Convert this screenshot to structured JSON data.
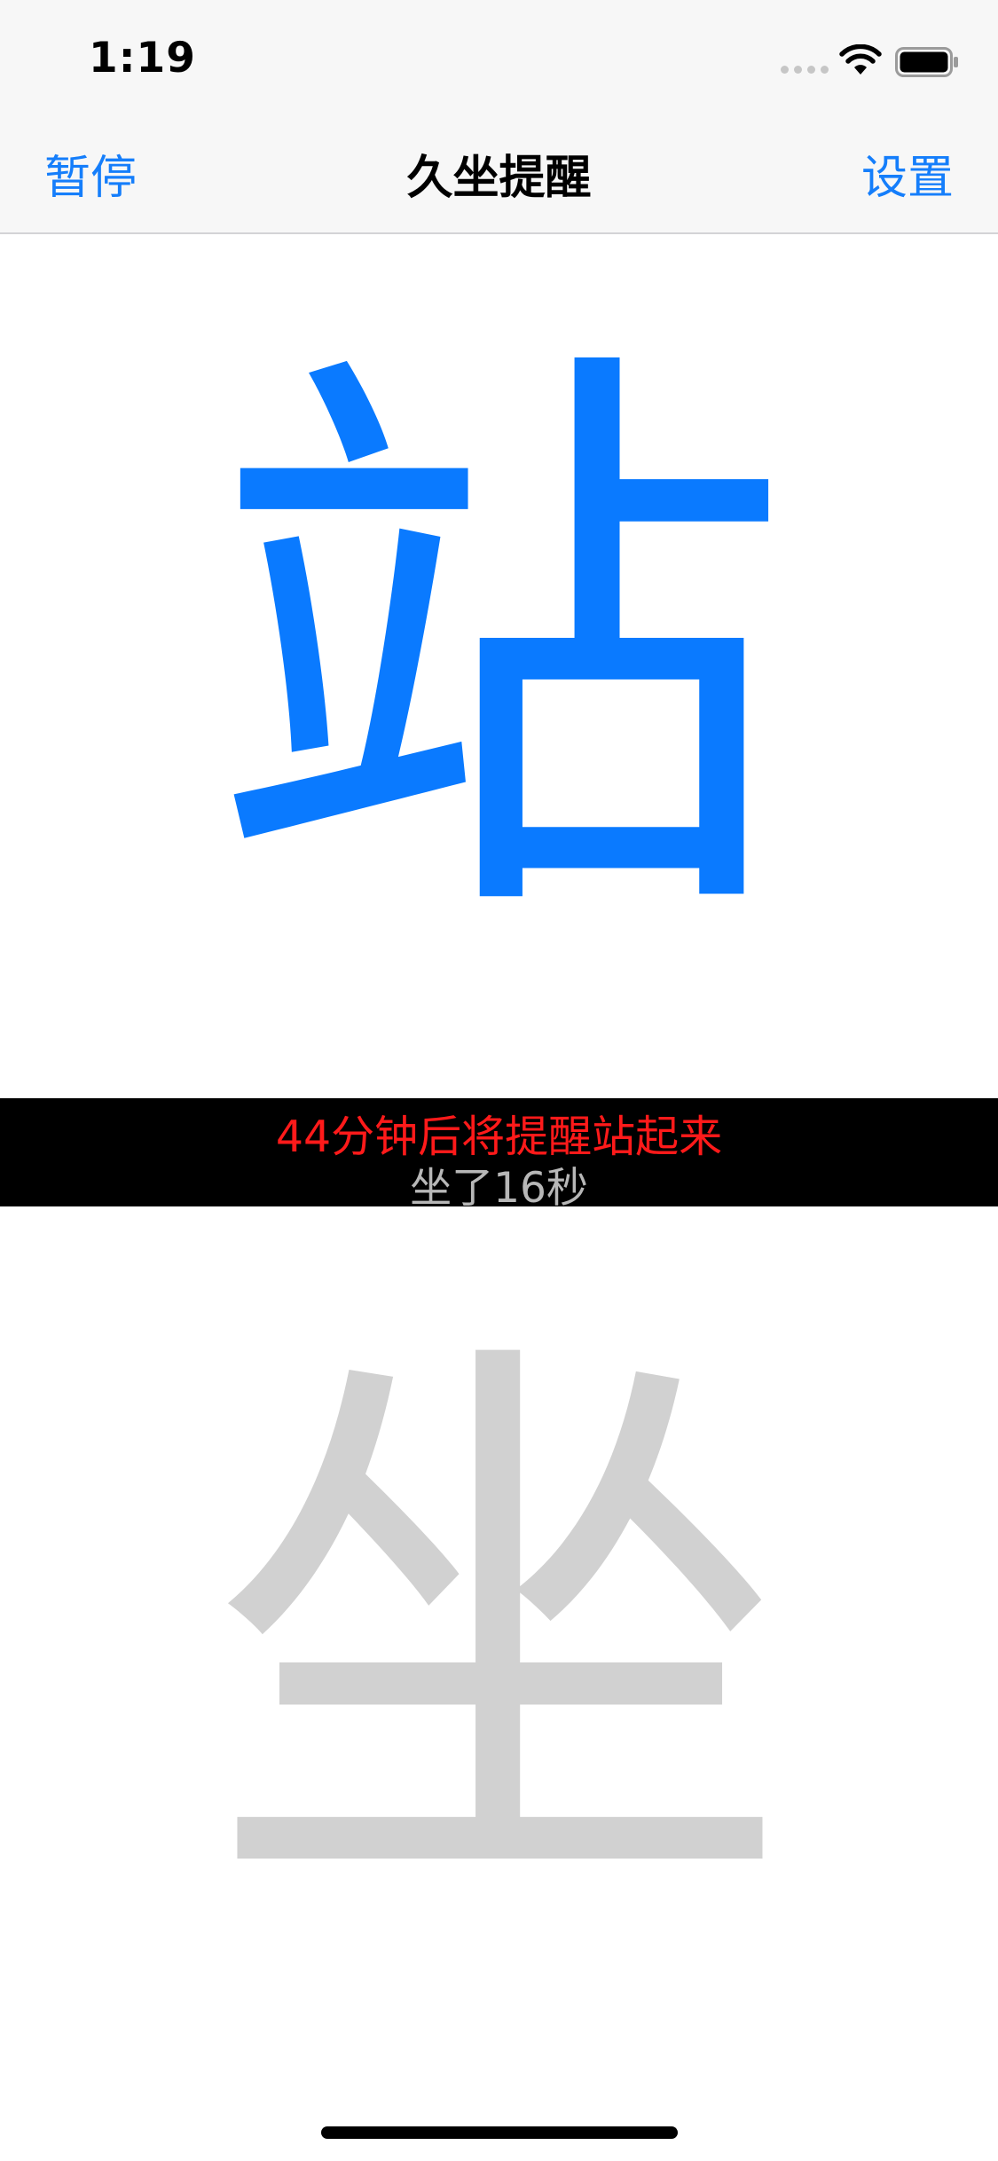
{
  "status_bar": {
    "time": "1:19",
    "icons": [
      "signal-icon",
      "wifi-icon",
      "battery-icon"
    ]
  },
  "nav": {
    "left_label": "暂停",
    "title": "久坐提醒",
    "right_label": "设置"
  },
  "stand": {
    "char": "站"
  },
  "info": {
    "reminder": "44分钟后将提醒站起来",
    "elapsed": "坐了16秒"
  },
  "sit": {
    "char": "坐"
  },
  "colors": {
    "accent": "#157efb",
    "stand_char": "#0a7aff",
    "sit_char": "#d1d1d1",
    "reminder_text": "#ff1a1a",
    "elapsed_text": "#b7b7b7",
    "band_background": "#000000",
    "bar_background": "#f7f7f7"
  }
}
